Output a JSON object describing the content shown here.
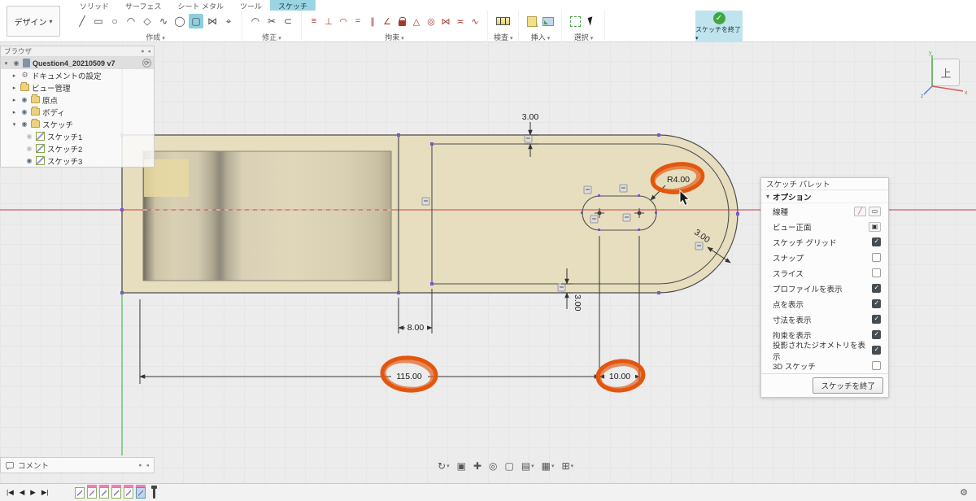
{
  "toolbar": {
    "design_menu": "デザイン",
    "tabs": [
      "ソリッド",
      "サーフェス",
      "シート メタル",
      "ツール",
      "スケッチ"
    ],
    "active_tab": "スケッチ",
    "group_labels": [
      "作成",
      "修正",
      "拘束",
      "検査",
      "挿入",
      "選択"
    ],
    "create_icons": [
      "╱",
      "▭",
      "○",
      "◠",
      "◇",
      "∿",
      "◯",
      "▢",
      "⋈",
      "⌖"
    ],
    "modify_icons": [
      "◠",
      "✂",
      "⊂"
    ],
    "constraint_icons": [
      "≡",
      "⊥",
      "◠",
      "=",
      "∥",
      "∠",
      "lock",
      "△",
      "◎",
      "⋈",
      "≍",
      "∿"
    ],
    "finish_label": "スケッチを終了",
    "finish_check": "✓"
  },
  "browser": {
    "title": "ブラウザ",
    "document": "Question4_20210509 v7",
    "items": [
      "ドキュメントの設定",
      "ビュー管理",
      "原点",
      "ボディ",
      "スケッチ"
    ],
    "sketches": [
      "スケッチ1",
      "スケッチ2",
      "スケッチ3"
    ]
  },
  "icons": {
    "eye": "◉",
    "gear": "⚙",
    "sync": "⟳",
    "expanded": "▾",
    "collapsed": "▸"
  },
  "viewcube": {
    "face": "上",
    "x_label": "x",
    "y_label": "y",
    "z_label": "z"
  },
  "palette": {
    "title": "スケッチ パレット",
    "section": "オプション",
    "rows": [
      {
        "label": "線種",
        "type": "icons"
      },
      {
        "label": "ビュー正面",
        "type": "button"
      },
      {
        "label": "スケッチ グリッド",
        "checked": true
      },
      {
        "label": "スナップ",
        "checked": false
      },
      {
        "label": "スライス",
        "checked": false
      },
      {
        "label": "プロファイルを表示",
        "checked": true
      },
      {
        "label": "点を表示",
        "checked": true
      },
      {
        "label": "寸法を表示",
        "checked": true
      },
      {
        "label": "拘束を表示",
        "checked": true
      },
      {
        "label": "投影されたジオメトリを表示",
        "checked": true
      },
      {
        "label": "3D スケッチ",
        "checked": false
      }
    ],
    "finish_button": "スケッチを終了"
  },
  "dimensions": {
    "top_offset": "3.00",
    "slot_radius": "R4.00",
    "arc_offset": "3.00",
    "bottom_offset": "3.00",
    "gap": "8.00",
    "total_length": "115.00",
    "slot_pitch": "10.00"
  },
  "comments": {
    "label": "コメント"
  },
  "navbar": {
    "icons": [
      "↻",
      "▣",
      "✚",
      "◎",
      "▢",
      "▤",
      "▦",
      "⊞"
    ]
  },
  "timeline": {
    "controls": [
      "|◀",
      "◀",
      "▶",
      "▶|"
    ],
    "gear": "⚙"
  }
}
